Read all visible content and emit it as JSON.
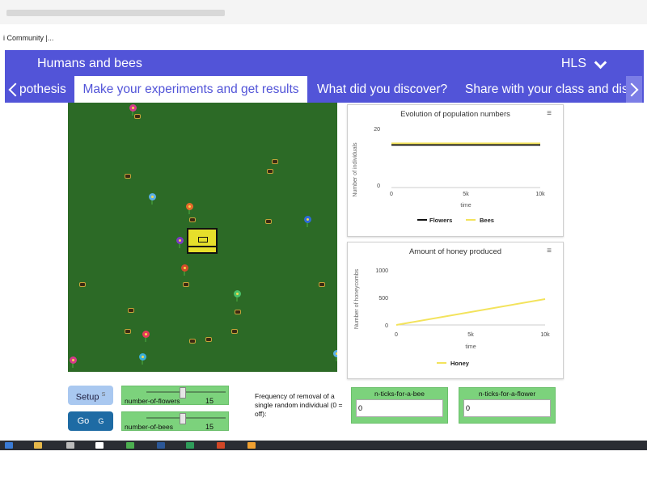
{
  "bookmarks": {
    "item": "i Community |..."
  },
  "app": {
    "title": "Humans and bees",
    "user_menu": "HLS"
  },
  "tabs": [
    {
      "label": "pothesis"
    },
    {
      "label": "Make your experiments and get results",
      "active": true
    },
    {
      "label": "What did you discover?"
    },
    {
      "label": "Share with your class and dis"
    }
  ],
  "charts": [
    {
      "title": "Evolution of population numbers",
      "ylabel": "Number of individuals",
      "xlabel": "time",
      "yticks": [
        "20",
        "0"
      ],
      "xticks": [
        "0",
        "5k",
        "10k"
      ],
      "legend": [
        "Flowers",
        "Bees"
      ]
    },
    {
      "title": "Amount of honey produced",
      "ylabel": "Number of honeycombs",
      "xlabel": "time",
      "yticks": [
        "1000",
        "500",
        "0"
      ],
      "xticks": [
        "0",
        "5k",
        "10k"
      ],
      "legend": [
        "Honey"
      ]
    }
  ],
  "chart_data": [
    {
      "type": "line",
      "title": "Evolution of population numbers",
      "xlabel": "time",
      "ylabel": "Number of individuals",
      "xlim": [
        0,
        10000
      ],
      "ylim": [
        0,
        25
      ],
      "series": [
        {
          "name": "Flowers",
          "color": "#111111",
          "x": [
            0,
            10000
          ],
          "y": [
            15,
            15
          ]
        },
        {
          "name": "Bees",
          "color": "#f3e35c",
          "x": [
            0,
            10000
          ],
          "y": [
            15.5,
            15.5
          ]
        }
      ]
    },
    {
      "type": "line",
      "title": "Amount of honey produced",
      "xlabel": "time",
      "ylabel": "Number of honeycombs",
      "xlim": [
        0,
        10000
      ],
      "ylim": [
        0,
        1000
      ],
      "series": [
        {
          "name": "Honey",
          "color": "#f3e35c",
          "x": [
            0,
            10000
          ],
          "y": [
            0,
            470
          ]
        }
      ]
    }
  ],
  "controls": {
    "setup_label": "Setup",
    "setup_key": "S",
    "go_label": "Go",
    "go_key": "G",
    "flowers_slider": {
      "label": "number-of-flowers",
      "value": "15",
      "fraction": 0.45
    },
    "bees_slider": {
      "label": "number-of-bees",
      "value": "15",
      "fraction": 0.45
    },
    "frequency_label": "Frequency of removal of a single random individual (0 = off):",
    "ticks_bee": {
      "label": "n-ticks-for-a-bee",
      "value": "0"
    },
    "ticks_flower": {
      "label": "n-ticks-for-a-flower",
      "value": "0"
    }
  }
}
